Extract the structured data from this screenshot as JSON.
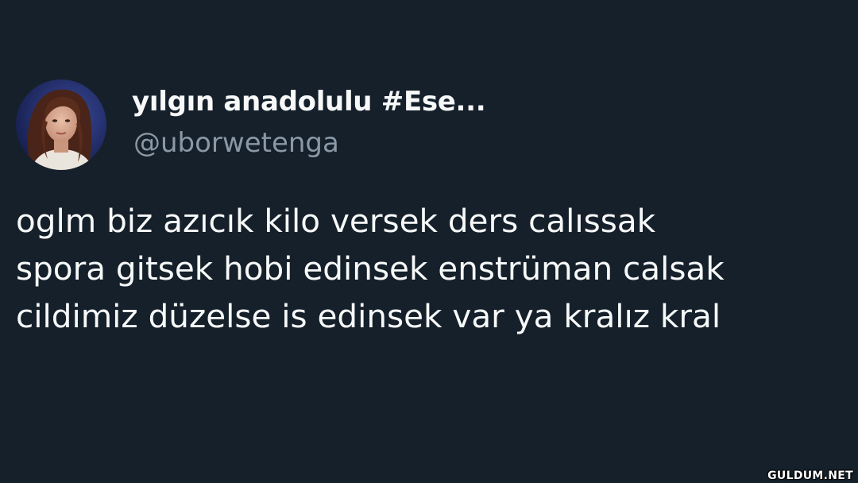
{
  "tweet": {
    "author": {
      "display_name": "yılgın anadolulu #Ese...",
      "handle": "@uborwetenga",
      "avatar": "profile-photo"
    },
    "text_lines": [
      "oglm biz azıcık kilo versek ders calıssak",
      "spora gitsek hobi edinsek enstrüman calsak",
      "cildimiz düzelse is edinsek var ya kralız kral"
    ]
  },
  "watermark": "GULDUM.NET",
  "colors": {
    "background": "#15202b",
    "text_primary": "#f7f9f9",
    "text_secondary": "#8b98a5"
  }
}
